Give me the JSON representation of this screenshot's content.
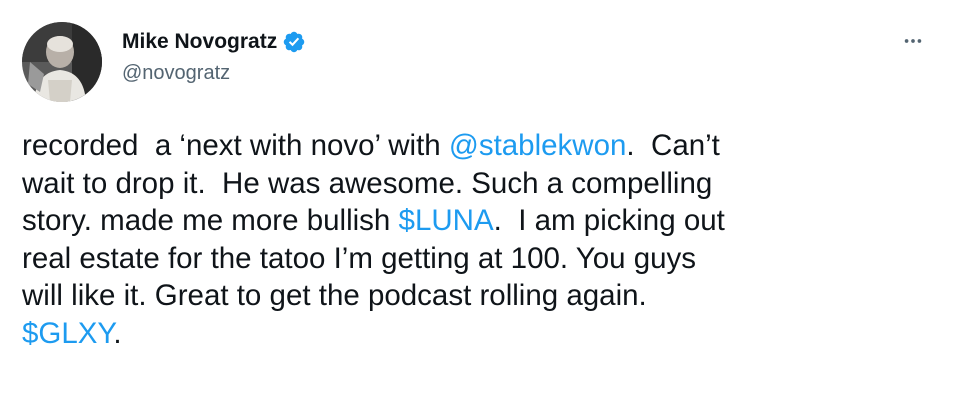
{
  "author": {
    "display_name": "Mike Novogratz",
    "handle": "@novogratz",
    "verified": true,
    "verified_color": "#1d9bf0"
  },
  "menu": {
    "more_icon": "more-horizontal-icon"
  },
  "tweet": {
    "lines": [
      {
        "before": "recorded  a ‘next with novo’ with ",
        "link": "@stablekwon",
        "after": ".  Can’t"
      },
      {
        "before": "wait to drop it.  He was awesome. Such a compelling",
        "link": "",
        "after": ""
      },
      {
        "before": "story. made me more bullish ",
        "link": "$LUNA",
        "after": ".  I am picking out"
      },
      {
        "before": "real estate for the tatoo I’m getting at 100. You guys",
        "link": "",
        "after": ""
      },
      {
        "before": "will like it. Great to get the podcast rolling again.",
        "link": "",
        "after": ""
      },
      {
        "before": "",
        "link": "$GLXY",
        "after": "."
      }
    ]
  },
  "colors": {
    "text": "#0f1419",
    "secondary": "#536471",
    "link": "#1d9bf0"
  }
}
